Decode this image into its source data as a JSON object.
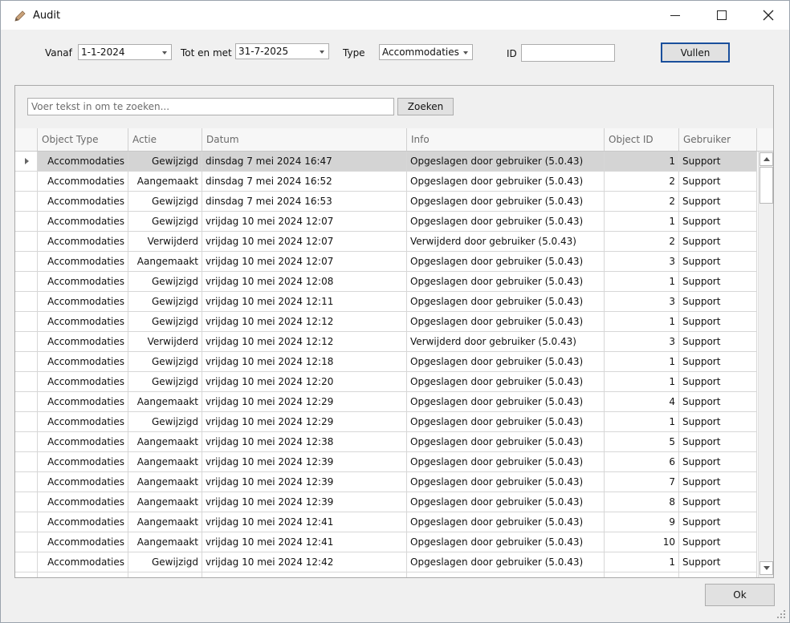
{
  "window": {
    "title": "Audit",
    "icon": "pencil-icon"
  },
  "filters": {
    "from_label": "Vanaf",
    "from_value": "1-1-2024",
    "to_label": "Tot en met",
    "to_value": "31-7-2025",
    "type_label": "Type",
    "type_value": "Accommodaties",
    "id_label": "ID",
    "id_value": "",
    "fill_button": "Vullen"
  },
  "search": {
    "placeholder": "Voer tekst in om te zoeken...",
    "button": "Zoeken"
  },
  "table": {
    "columns": [
      "Object Type",
      "Actie",
      "Datum",
      "Info",
      "Object ID",
      "Gebruiker"
    ],
    "selected_row": 0,
    "rows": [
      [
        "Accommodaties",
        "Gewijzigd",
        "dinsdag 7 mei 2024 16:47",
        "Opgeslagen door gebruiker (5.0.43)",
        "1",
        "Support"
      ],
      [
        "Accommodaties",
        "Aangemaakt",
        "dinsdag 7 mei 2024 16:52",
        "Opgeslagen door gebruiker (5.0.43)",
        "2",
        "Support"
      ],
      [
        "Accommodaties",
        "Gewijzigd",
        "dinsdag 7 mei 2024 16:53",
        "Opgeslagen door gebruiker (5.0.43)",
        "2",
        "Support"
      ],
      [
        "Accommodaties",
        "Gewijzigd",
        "vrijdag 10 mei 2024 12:07",
        "Opgeslagen door gebruiker (5.0.43)",
        "1",
        "Support"
      ],
      [
        "Accommodaties",
        "Verwijderd",
        "vrijdag 10 mei 2024 12:07",
        "Verwijderd door gebruiker (5.0.43)",
        "2",
        "Support"
      ],
      [
        "Accommodaties",
        "Aangemaakt",
        "vrijdag 10 mei 2024 12:07",
        "Opgeslagen door gebruiker (5.0.43)",
        "3",
        "Support"
      ],
      [
        "Accommodaties",
        "Gewijzigd",
        "vrijdag 10 mei 2024 12:08",
        "Opgeslagen door gebruiker (5.0.43)",
        "1",
        "Support"
      ],
      [
        "Accommodaties",
        "Gewijzigd",
        "vrijdag 10 mei 2024 12:11",
        "Opgeslagen door gebruiker (5.0.43)",
        "3",
        "Support"
      ],
      [
        "Accommodaties",
        "Gewijzigd",
        "vrijdag 10 mei 2024 12:12",
        "Opgeslagen door gebruiker (5.0.43)",
        "1",
        "Support"
      ],
      [
        "Accommodaties",
        "Verwijderd",
        "vrijdag 10 mei 2024 12:12",
        "Verwijderd door gebruiker (5.0.43)",
        "3",
        "Support"
      ],
      [
        "Accommodaties",
        "Gewijzigd",
        "vrijdag 10 mei 2024 12:18",
        "Opgeslagen door gebruiker (5.0.43)",
        "1",
        "Support"
      ],
      [
        "Accommodaties",
        "Gewijzigd",
        "vrijdag 10 mei 2024 12:20",
        "Opgeslagen door gebruiker (5.0.43)",
        "1",
        "Support"
      ],
      [
        "Accommodaties",
        "Aangemaakt",
        "vrijdag 10 mei 2024 12:29",
        "Opgeslagen door gebruiker (5.0.43)",
        "4",
        "Support"
      ],
      [
        "Accommodaties",
        "Gewijzigd",
        "vrijdag 10 mei 2024 12:29",
        "Opgeslagen door gebruiker (5.0.43)",
        "1",
        "Support"
      ],
      [
        "Accommodaties",
        "Aangemaakt",
        "vrijdag 10 mei 2024 12:38",
        "Opgeslagen door gebruiker (5.0.43)",
        "5",
        "Support"
      ],
      [
        "Accommodaties",
        "Aangemaakt",
        "vrijdag 10 mei 2024 12:39",
        "Opgeslagen door gebruiker (5.0.43)",
        "6",
        "Support"
      ],
      [
        "Accommodaties",
        "Aangemaakt",
        "vrijdag 10 mei 2024 12:39",
        "Opgeslagen door gebruiker (5.0.43)",
        "7",
        "Support"
      ],
      [
        "Accommodaties",
        "Aangemaakt",
        "vrijdag 10 mei 2024 12:39",
        "Opgeslagen door gebruiker (5.0.43)",
        "8",
        "Support"
      ],
      [
        "Accommodaties",
        "Aangemaakt",
        "vrijdag 10 mei 2024 12:41",
        "Opgeslagen door gebruiker (5.0.43)",
        "9",
        "Support"
      ],
      [
        "Accommodaties",
        "Aangemaakt",
        "vrijdag 10 mei 2024 12:41",
        "Opgeslagen door gebruiker (5.0.43)",
        "10",
        "Support"
      ],
      [
        "Accommodaties",
        "Gewijzigd",
        "vrijdag 10 mei 2024 12:42",
        "Opgeslagen door gebruiker (5.0.43)",
        "1",
        "Support"
      ],
      [
        "",
        "",
        "",
        "",
        "",
        ""
      ]
    ]
  },
  "footer": {
    "ok_button": "Ok"
  },
  "colors": {
    "selected_row": "#d4d4d4",
    "default_button_border": "#1a4f9c"
  }
}
